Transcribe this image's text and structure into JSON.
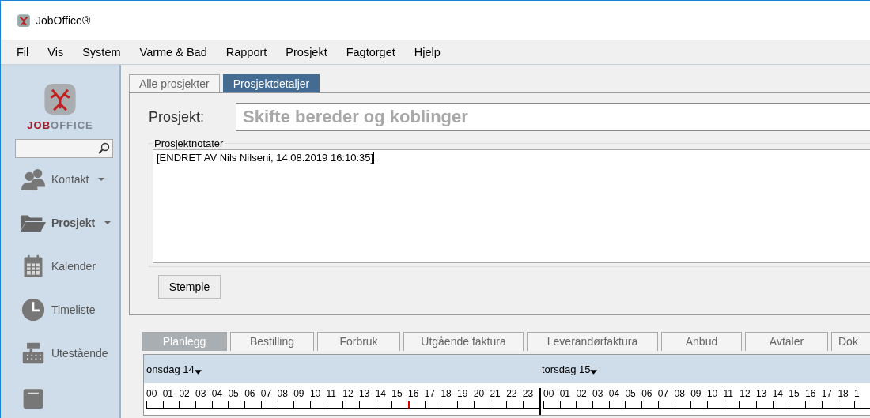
{
  "window": {
    "title": "JobOffice®"
  },
  "menu": [
    "Fil",
    "Vis",
    "System",
    "Varme & Bad",
    "Rapport",
    "Prosjekt",
    "Fagtorget",
    "Hjelp"
  ],
  "sidebar": {
    "logo_text_bold": "JOB",
    "logo_text": "OFFICE",
    "items": [
      {
        "label": "Kontakt",
        "kind": "contacts",
        "has_dropdown": true,
        "selected": false
      },
      {
        "label": "Prosjekt",
        "kind": "folder",
        "has_dropdown": true,
        "selected": true
      },
      {
        "label": "Kalender",
        "kind": "calendar",
        "has_dropdown": false,
        "selected": false
      },
      {
        "label": "Timeliste",
        "kind": "clock",
        "has_dropdown": false,
        "selected": false
      },
      {
        "label": "Utestående",
        "kind": "register",
        "has_dropdown": false,
        "selected": false
      },
      {
        "kind": "document",
        "has_dropdown": false,
        "selected": false
      }
    ]
  },
  "tabs": [
    {
      "label": "Alle prosjekter",
      "selected": false
    },
    {
      "label": "Prosjektdetaljer",
      "selected": true
    }
  ],
  "project": {
    "label": "Prosjekt:",
    "value": "Skifte bereder og koblinger"
  },
  "notes": {
    "legend": "Prosjektnotater",
    "value": "[ENDRET AV Nils Nilseni, 14.08.2019 16:10:35]"
  },
  "stamp_button": "Stemple",
  "detail_tabs": [
    {
      "label": "Planlegg",
      "selected": true
    },
    {
      "label": "Bestilling",
      "selected": false
    },
    {
      "label": "Forbruk",
      "selected": false
    },
    {
      "label": "Utgående faktura",
      "selected": false
    },
    {
      "label": "Leverandørfaktura",
      "selected": false
    },
    {
      "label": "Anbud",
      "selected": false
    },
    {
      "label": "Avtaler",
      "selected": false
    },
    {
      "label": "Dok",
      "selected": false
    }
  ],
  "schedule": {
    "days": [
      {
        "label": "onsdag 14",
        "hours": [
          {
            "label": "00",
            "now": false
          },
          {
            "label": "01",
            "now": false
          },
          {
            "label": "02",
            "now": false
          },
          {
            "label": "03",
            "now": false
          },
          {
            "label": "04",
            "now": false
          },
          {
            "label": "05",
            "now": false
          },
          {
            "label": "06",
            "now": false
          },
          {
            "label": "07",
            "now": false
          },
          {
            "label": "08",
            "now": false
          },
          {
            "label": "09",
            "now": false
          },
          {
            "label": "10",
            "now": false
          },
          {
            "label": "11",
            "now": false
          },
          {
            "label": "12",
            "now": false
          },
          {
            "label": "13",
            "now": false
          },
          {
            "label": "14",
            "now": false
          },
          {
            "label": "15",
            "now": false
          },
          {
            "label": "16",
            "now": true
          },
          {
            "label": "17",
            "now": false
          },
          {
            "label": "18",
            "now": false
          },
          {
            "label": "19",
            "now": false
          },
          {
            "label": "20",
            "now": false
          },
          {
            "label": "21",
            "now": false
          },
          {
            "label": "22",
            "now": false
          },
          {
            "label": "23",
            "now": false
          }
        ]
      },
      {
        "label": "torsdag 15",
        "hours": [
          {
            "label": "00",
            "now": false
          },
          {
            "label": "01",
            "now": false
          },
          {
            "label": "02",
            "now": false
          },
          {
            "label": "03",
            "now": false
          },
          {
            "label": "04",
            "now": false
          },
          {
            "label": "05",
            "now": false
          },
          {
            "label": "06",
            "now": false
          },
          {
            "label": "07",
            "now": false
          },
          {
            "label": "08",
            "now": false
          },
          {
            "label": "09",
            "now": false
          },
          {
            "label": "10",
            "now": false
          },
          {
            "label": "11",
            "now": false
          },
          {
            "label": "12",
            "now": false
          },
          {
            "label": "13",
            "now": false
          },
          {
            "label": "14",
            "now": false
          },
          {
            "label": "15",
            "now": false
          },
          {
            "label": "16",
            "now": false
          },
          {
            "label": "17",
            "now": false
          },
          {
            "label": "18",
            "now": false
          },
          {
            "label": "1",
            "now": false
          }
        ]
      }
    ]
  }
}
